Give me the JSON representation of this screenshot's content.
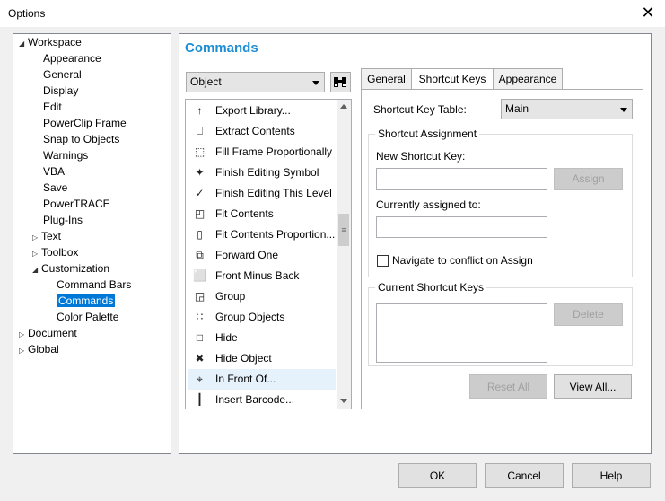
{
  "window": {
    "title": "Options",
    "close_glyph": "✕"
  },
  "tree": [
    {
      "label": "Workspace",
      "toggle": "◢",
      "depth": 0
    },
    {
      "label": "Appearance",
      "toggle": "",
      "depth": 1
    },
    {
      "label": "General",
      "toggle": "",
      "depth": 1
    },
    {
      "label": "Display",
      "toggle": "",
      "depth": 1
    },
    {
      "label": "Edit",
      "toggle": "",
      "depth": 1
    },
    {
      "label": "PowerClip Frame",
      "toggle": "",
      "depth": 1
    },
    {
      "label": "Snap to Objects",
      "toggle": "",
      "depth": 1
    },
    {
      "label": "Warnings",
      "toggle": "",
      "depth": 1
    },
    {
      "label": "VBA",
      "toggle": "",
      "depth": 1
    },
    {
      "label": "Save",
      "toggle": "",
      "depth": 1
    },
    {
      "label": "PowerTRACE",
      "toggle": "",
      "depth": 1
    },
    {
      "label": "Plug-Ins",
      "toggle": "",
      "depth": 1
    },
    {
      "label": "Text",
      "toggle": "▷",
      "depth": 1
    },
    {
      "label": "Toolbox",
      "toggle": "▷",
      "depth": 1
    },
    {
      "label": "Customization",
      "toggle": "◢",
      "depth": 1
    },
    {
      "label": "Command Bars",
      "toggle": "",
      "depth": 2
    },
    {
      "label": "Commands",
      "toggle": "",
      "depth": 2,
      "selected": true
    },
    {
      "label": "Color Palette",
      "toggle": "",
      "depth": 2
    },
    {
      "label": "Document",
      "toggle": "▷",
      "depth": 0
    },
    {
      "label": "Global",
      "toggle": "▷",
      "depth": 0
    }
  ],
  "panel": {
    "heading": "Commands"
  },
  "category_select": {
    "value": "Object"
  },
  "find_button_icon": "binoculars-icon",
  "commands": [
    {
      "label": "Export Library...",
      "icon": "↑"
    },
    {
      "label": "Extract Contents",
      "icon": "⎕"
    },
    {
      "label": "Fill Frame Proportionally",
      "icon": "⬚"
    },
    {
      "label": "Finish Editing Symbol",
      "icon": "✦"
    },
    {
      "label": "Finish Editing This Level",
      "icon": "✓"
    },
    {
      "label": "Fit Contents",
      "icon": "◰"
    },
    {
      "label": "Fit Contents Proportion...",
      "icon": "▯"
    },
    {
      "label": "Forward One",
      "icon": "⧉"
    },
    {
      "label": "Front Minus Back",
      "icon": "⬜"
    },
    {
      "label": "Group",
      "icon": "◲"
    },
    {
      "label": "Group Objects",
      "icon": "∷"
    },
    {
      "label": "Hide",
      "icon": "□"
    },
    {
      "label": "Hide Object",
      "icon": "✖"
    },
    {
      "label": "In Front Of...",
      "icon": "⌖",
      "highlighted": true
    },
    {
      "label": "Insert Barcode...",
      "icon": "┃"
    }
  ],
  "tabs": [
    {
      "label": "General"
    },
    {
      "label": "Shortcut Keys",
      "active": true
    },
    {
      "label": "Appearance"
    }
  ],
  "shortcut": {
    "table_label": "Shortcut Key Table:",
    "table_value": "Main",
    "assignment_group": "Shortcut Assignment",
    "new_key_label": "New Shortcut Key:",
    "new_key_value": "",
    "assign_label": "Assign",
    "currently_assigned_label": "Currently assigned to:",
    "currently_assigned_value": "",
    "navigate_label": "Navigate to conflict on Assign",
    "navigate_checked": false,
    "current_keys_group": "Current Shortcut Keys",
    "delete_label": "Delete",
    "reset_all_label": "Reset All",
    "view_all_label": "View All..."
  },
  "footer": {
    "ok": "OK",
    "cancel": "Cancel",
    "help": "Help"
  }
}
